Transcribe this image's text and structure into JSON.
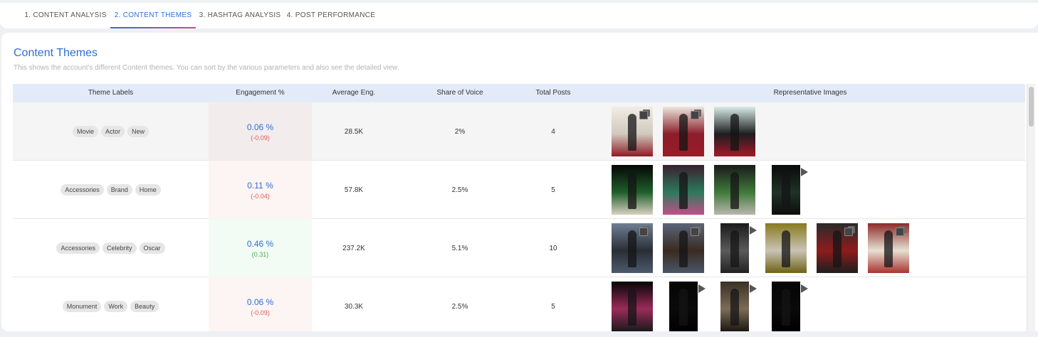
{
  "tabs": [
    {
      "label": "1. CONTENT ANALYSIS"
    },
    {
      "label": "2. CONTENT THEMES"
    },
    {
      "label": "3. HASHTAG ANALYSIS"
    },
    {
      "label": "4. POST PERFORMANCE"
    }
  ],
  "active_tab_index": 1,
  "section": {
    "title": "Content Themes",
    "subtitle": "This shows the account's different Content themes. You can sort by the various parameters and also see the detailed view."
  },
  "table": {
    "headers": [
      "Theme Labels",
      "Engagement %",
      "Average Eng.",
      "Share of Voice",
      "Total Posts",
      "Representative Images"
    ],
    "rows": [
      {
        "labels": [
          "Movie",
          "Actor",
          "New"
        ],
        "engagement": "0.06 %",
        "engagement_delta": "(-0.09)",
        "delta_sign": "negative",
        "avg_eng": "28.5K",
        "share_of_voice": "2%",
        "total_posts": "4",
        "images": [
          {
            "badge": "multi-image-icon",
            "colors": [
              "#f2ede6",
              "#cfc8bd",
              "#8f1b24"
            ]
          },
          {
            "badge": "multi-image-icon",
            "colors": [
              "#ece7df",
              "#8a1e2a",
              "#9b1b27"
            ]
          },
          {
            "badge": "",
            "colors": [
              "#d9ece8",
              "#1d1d1f",
              "#a3192a"
            ]
          }
        ]
      },
      {
        "labels": [
          "Accessories",
          "Brand",
          "Home"
        ],
        "engagement": "0.11 %",
        "engagement_delta": "(-0.04)",
        "delta_sign": "negative",
        "avg_eng": "57.8K",
        "share_of_voice": "2.5%",
        "total_posts": "5",
        "images": [
          {
            "badge": "",
            "colors": [
              "#050505",
              "#1f5f2a",
              "#d8d0c0"
            ]
          },
          {
            "badge": "",
            "colors": [
              "#3a1f2e",
              "#2c7a5c",
              "#c04f88"
            ]
          },
          {
            "badge": "",
            "colors": [
              "#1a1a1a",
              "#3f7a3a",
              "#b9b6ae"
            ]
          },
          {
            "badge": "play-icon",
            "colors": [
              "#0a0a0a",
              "#1f3327",
              "#0d0d0d"
            ]
          }
        ]
      },
      {
        "labels": [
          "Accessories",
          "Celebrity",
          "Oscar"
        ],
        "engagement": "0.46 %",
        "engagement_delta": "(0.31)",
        "delta_sign": "positive",
        "avg_eng": "237.2K",
        "share_of_voice": "5.1%",
        "total_posts": "10",
        "images": [
          {
            "badge": "multi-image-icon",
            "colors": [
              "#6f7f93",
              "#2a2e35",
              "#4c5a6e"
            ]
          },
          {
            "badge": "multi-image-icon",
            "colors": [
              "#5b6678",
              "#3a2a22",
              "#4a5668"
            ]
          },
          {
            "badge": "play-icon",
            "colors": [
              "#1b1b1b",
              "#5a5a5a",
              "#222"
            ]
          },
          {
            "badge": "",
            "colors": [
              "#8a7a1e",
              "#c9c3b6",
              "#6f6216"
            ]
          },
          {
            "badge": "multi-image-icon",
            "colors": [
              "#2b2b2b",
              "#8e1c1c",
              "#1e1e1e"
            ]
          },
          {
            "badge": "multi-image-icon",
            "colors": [
              "#8e2a28",
              "#e7e0d2",
              "#a83430"
            ]
          }
        ]
      },
      {
        "labels": [
          "Monument",
          "Work",
          "Beauty"
        ],
        "engagement": "0.06 %",
        "engagement_delta": "(-0.09)",
        "delta_sign": "negative",
        "avg_eng": "30.3K",
        "share_of_voice": "2.5%",
        "total_posts": "5",
        "images": [
          {
            "badge": "",
            "colors": [
              "#050505",
              "#9c2b5a",
              "#1a1a1a"
            ]
          },
          {
            "badge": "play-icon",
            "colors": [
              "#050505",
              "#0a0a0a",
              "#000"
            ]
          },
          {
            "badge": "play-icon",
            "colors": [
              "#3a3026",
              "#7c6c56",
              "#1c1812"
            ]
          },
          {
            "badge": "play-icon",
            "colors": [
              "#050505",
              "#0a0a0a",
              "#000"
            ]
          }
        ]
      }
    ]
  }
}
